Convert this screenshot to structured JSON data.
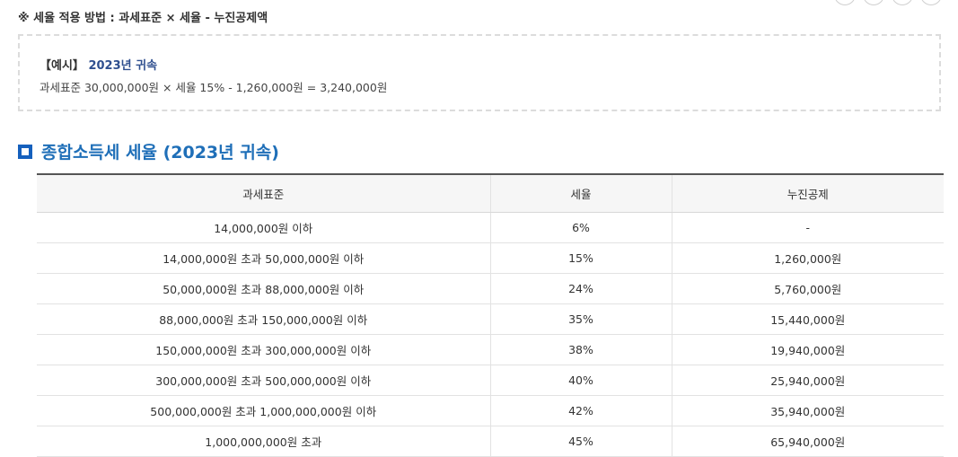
{
  "method": {
    "text": "※ 세율 적용 방법 : 과세표준 × 세율 - 누진공제액"
  },
  "example": {
    "bracket_label": "【예시】",
    "year_label": "2023년 귀속",
    "formula": "과세표준 30,000,000원 × 세율 15% - 1,260,000원 = 3,240,000원"
  },
  "section": {
    "title": "종합소득세 세율 (2023년 귀속)"
  },
  "table": {
    "headers": [
      "과세표준",
      "세율",
      "누진공제"
    ],
    "rows": [
      {
        "base": "14,000,000원 이하",
        "rate": "6%",
        "deduction": "-"
      },
      {
        "base": "14,000,000원 초과 50,000,000원 이하",
        "rate": "15%",
        "deduction": "1,260,000원"
      },
      {
        "base": "50,000,000원 초과 88,000,000원 이하",
        "rate": "24%",
        "deduction": "5,760,000원"
      },
      {
        "base": "88,000,000원 초과 150,000,000원 이하",
        "rate": "35%",
        "deduction": "15,440,000원"
      },
      {
        "base": "150,000,000원 초과 300,000,000원 이하",
        "rate": "38%",
        "deduction": "19,940,000원"
      },
      {
        "base": "300,000,000원 초과 500,000,000원 이하",
        "rate": "40%",
        "deduction": "25,940,000원"
      },
      {
        "base": "500,000,000원 초과 1,000,000,000원 이하",
        "rate": "42%",
        "deduction": "35,940,000원"
      },
      {
        "base": "1,000,000,000원 초과",
        "rate": "45%",
        "deduction": "65,940,000원"
      }
    ]
  },
  "colors": {
    "accent_blue": "#1f6fb8",
    "icon_blue": "#1560bd",
    "example_year": "#2f4f8f"
  },
  "icons": {
    "section_icon": "square-bullet-icon"
  }
}
